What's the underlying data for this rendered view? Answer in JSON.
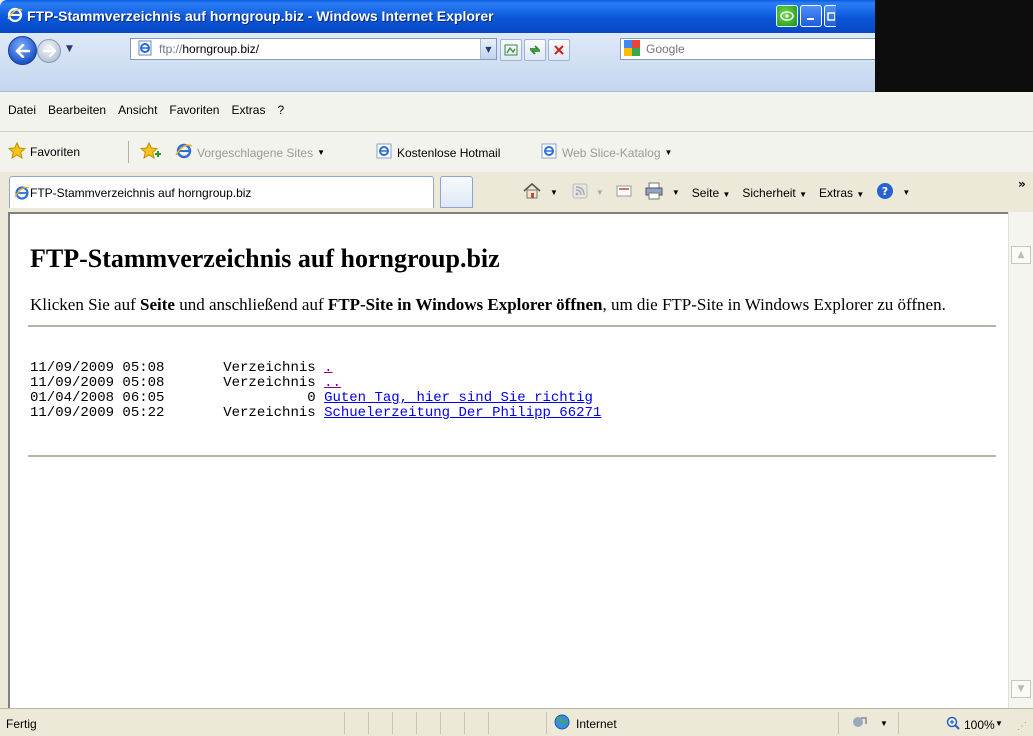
{
  "window": {
    "title": "FTP-Stammverzeichnis auf horngroup.biz - Windows Internet Explorer"
  },
  "address_bar": {
    "url_protocol": "ftp://",
    "url_host": "horngroup.biz/",
    "search_placeholder": "Google"
  },
  "menu": {
    "items": [
      "Datei",
      "Bearbeiten",
      "Ansicht",
      "Favoriten",
      "Extras",
      "?"
    ]
  },
  "favorites_bar": {
    "favorites_label": "Favoriten",
    "suggested_sites": "Vorgeschlagene Sites",
    "hotmail": "Kostenlose Hotmail",
    "web_slice": "Web Slice-Katalog"
  },
  "tab": {
    "label": "FTP-Stammverzeichnis auf horngroup.biz"
  },
  "command_bar": {
    "page": "Seite",
    "security": "Sicherheit",
    "tools": "Extras"
  },
  "page": {
    "heading": "FTP-Stammverzeichnis auf horngroup.biz",
    "intro_1": "Klicken Sie auf ",
    "intro_bold_1": "Seite",
    "intro_2": " und anschließend auf ",
    "intro_bold_2": "FTP-Site in Windows Explorer öffnen",
    "intro_3": ", um die FTP-Site in Windows Explorer zu öffnen.",
    "entries": [
      {
        "date": "11/09/2009 05:08",
        "type": "       Verzeichnis",
        "name": ".",
        "visited": true
      },
      {
        "date": "11/09/2009 05:08",
        "type": "       Verzeichnis",
        "name": "..",
        "visited": true
      },
      {
        "date": "01/04/2008 06:05",
        "type": "                 0",
        "name": "Guten Tag, hier sind Sie richtig",
        "visited": false
      },
      {
        "date": "11/09/2009 05:22",
        "type": "       Verzeichnis",
        "name": "Schuelerzeitung_Der_Philipp_66271",
        "visited": false
      }
    ]
  },
  "status_bar": {
    "status": "Fertig",
    "zone": "Internet",
    "zoom": "100%"
  },
  "colors": {
    "titlebar": "#0a56d8",
    "link": "#0000ee",
    "visited_link": "#800080"
  }
}
